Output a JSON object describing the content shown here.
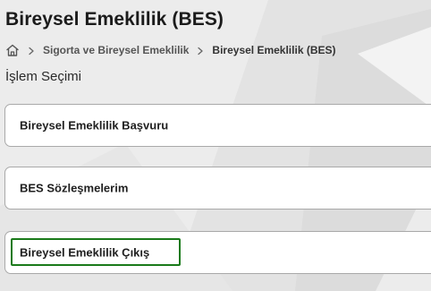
{
  "page": {
    "title": "Bireysel Emeklilik (BES)"
  },
  "breadcrumb": {
    "home_icon": "home-icon",
    "separator_icon": "chevron-right-icon",
    "items": [
      "Sigorta ve Bireysel Emeklilik",
      "Bireysel Emeklilik (BES)"
    ]
  },
  "section": {
    "title": "İşlem Seçimi"
  },
  "options": [
    {
      "label": "Bireysel Emeklilik Başvuru"
    },
    {
      "label": "BES Sözleşmelerim"
    },
    {
      "label": "Bireysel Emeklilik Çıkış",
      "focused": true
    }
  ],
  "colors": {
    "focus_ring": "#1a7a1a",
    "card_border": "#a9a9a9",
    "background": "#eeeeee"
  }
}
